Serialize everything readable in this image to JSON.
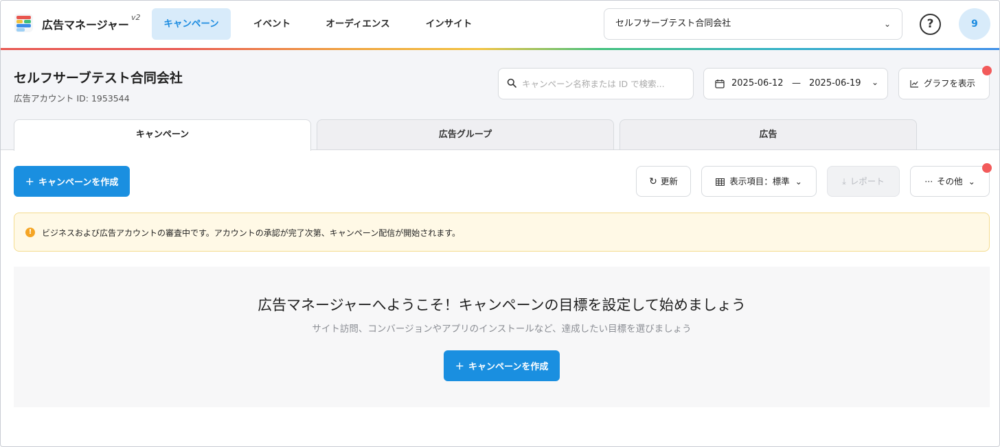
{
  "app": {
    "name": "広告マネージャー",
    "version": "v2"
  },
  "nav": {
    "tabs": [
      {
        "label": "キャンペーン",
        "active": true
      },
      {
        "label": "イベント",
        "active": false
      },
      {
        "label": "オーディエンス",
        "active": false
      },
      {
        "label": "インサイト",
        "active": false
      }
    ],
    "company_select_value": "セルフサーブテスト合同会社",
    "avatar_text": "9"
  },
  "account": {
    "name": "セルフサーブテスト合同会社",
    "id_label": "広告アカウント ID: 1953544"
  },
  "search": {
    "placeholder": "キャンペーン名称または ID で検索...",
    "value": ""
  },
  "date_range": {
    "start": "2025-06-12",
    "separator": "—",
    "end": "2025-06-19"
  },
  "graph_button_label": "グラフを表示",
  "content_tabs": [
    {
      "label": "キャンペーン",
      "active": true
    },
    {
      "label": "広告グループ",
      "active": false
    },
    {
      "label": "広告",
      "active": false
    }
  ],
  "toolbar": {
    "create_label": "キャンペーンを作成",
    "refresh_label": "更新",
    "columns_label": "表示項目：標準",
    "report_label": "レポート",
    "more_label": "その他"
  },
  "notice": {
    "text": "ビジネスおよび広告アカウントの審査中です。アカウントの承認が完了次第、キャンペーン配信が開始されます。"
  },
  "welcome": {
    "title": "広告マネージャーへようこそ！キャンペーンの目標を設定して始めましょう",
    "subtitle": "サイト訪問、コンバージョンやアプリのインストールなど、達成したい目標を選びましょう",
    "create_label": "キャンペーンを作成"
  },
  "colors": {
    "accent": "#1a8fe0",
    "accent_light": "#d8ebfa",
    "notice_bg": "#fff9e6",
    "notification_dot": "#f25a5a"
  }
}
